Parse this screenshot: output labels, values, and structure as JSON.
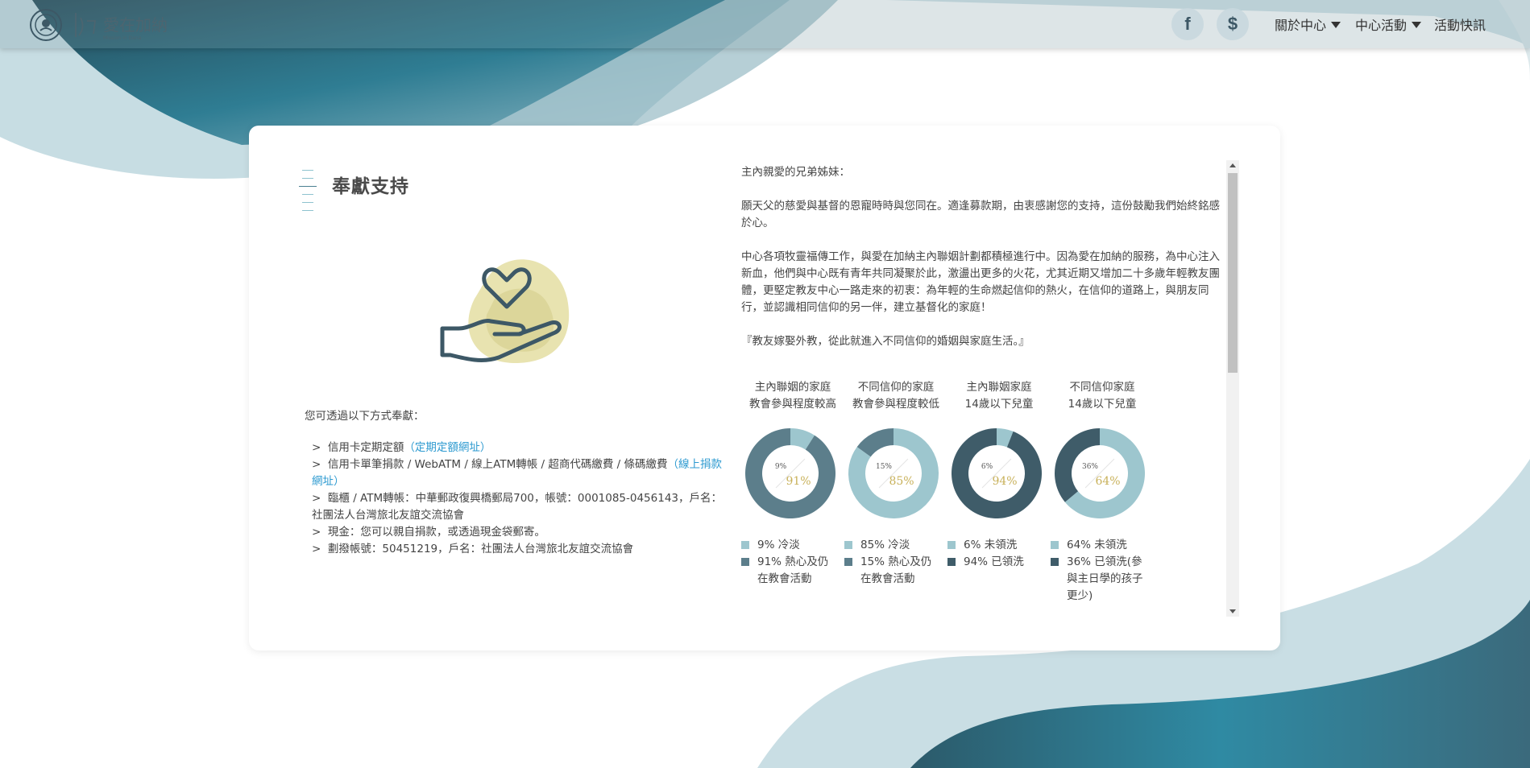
{
  "header": {
    "logo_alt": "愛在加納",
    "logo_subtitle": "Mission in Dana",
    "social": [
      {
        "name": "facebook-icon",
        "glyph": "f"
      },
      {
        "name": "donate-icon",
        "glyph": "$"
      }
    ],
    "nav": [
      {
        "label": "關於中心"
      },
      {
        "label": "中心活動"
      },
      {
        "label": "活動快訊"
      }
    ]
  },
  "page": {
    "title": "奉獻支持",
    "methods_intro": "您可透過以下方式奉獻：",
    "methods": [
      {
        "text": "信用卡定期定額",
        "link": "（定期定額網址）"
      },
      {
        "text": "信用卡單筆捐款 / WebATM / 線上ATM轉帳 / 超商代碼繳費 / 條碼繳費",
        "link": "（線上捐款網址）"
      },
      {
        "text": "臨櫃 / ATM轉帳：中華郵政復興橋郵局700，帳號：0001085-0456143，戶名：社團法人台灣旅北友誼交流協會",
        "link": ""
      },
      {
        "text": "現金：您可以親自捐款，或透過現金袋郵寄。",
        "link": ""
      },
      {
        "text": "劃撥帳號：50451219，戶名：社團法人台灣旅北友誼交流協會",
        "link": ""
      }
    ],
    "bullet": ">"
  },
  "letter": {
    "greeting": "主內親愛的兄弟姊妹：",
    "p1": "願天父的慈愛與基督的恩寵時時與您同在。適逢募款期，由衷感謝您的支持，這份鼓勵我們始終銘感於心。",
    "p2": "中心各項牧靈福傳工作，與愛在加納主內聯姻計劃都積極進行中。因為愛在加納的服務，為中心注入新血，他們與中心既有青年共同凝聚於此，激盪出更多的火花，尤其近期又增加二十多歲年輕教友團體，更堅定教友中心一路走來的初衷：為年輕的生命燃起信仰的熱火，在信仰的道路上，與朋友同行，並認識相同信仰的另一伴，建立基督化的家庭！",
    "p3": "『教友嫁娶外教，從此就進入不同信仰的婚姻與家庭生活。』"
  },
  "colors": {
    "light": "#9dc6ce",
    "dark": "#3f5c69",
    "mid": "#5c7e8b",
    "gold": "#c8b15a",
    "link": "#2d9ad0"
  },
  "chart_data": [
    {
      "type": "pie",
      "title": "主內聯姻的家庭\n教會參與程度較高",
      "title_lines": [
        "主內聯姻的家庭",
        "教會參與程度較高"
      ],
      "slices": [
        {
          "label": "9% 冷淡",
          "value": 9,
          "color": "#9dc6ce"
        },
        {
          "label": "91% 熱心及仍在教會活動",
          "value": 91,
          "color": "#5c7e8b"
        }
      ],
      "small_label": "9%",
      "big_label": "91%"
    },
    {
      "type": "pie",
      "title_lines": [
        "不同信仰的家庭",
        "教會參與程度較低"
      ],
      "slices": [
        {
          "label": "85% 冷淡",
          "value": 85,
          "color": "#9dc6ce"
        },
        {
          "label": "15% 熱心及仍在教會活動",
          "value": 15,
          "color": "#5c7e8b"
        }
      ],
      "small_label": "15%",
      "big_label": "85%"
    },
    {
      "type": "pie",
      "title_lines": [
        "主內聯姻家庭",
        "14歲以下兒童"
      ],
      "slices": [
        {
          "label": "6% 未領洗",
          "value": 6,
          "color": "#9dc6ce"
        },
        {
          "label": "94% 已領洗",
          "value": 94,
          "color": "#3f5c69"
        }
      ],
      "small_label": "6%",
      "big_label": "94%"
    },
    {
      "type": "pie",
      "title_lines": [
        "不同信仰家庭",
        "14歲以下兒童"
      ],
      "slices": [
        {
          "label": "64% 未領洗",
          "value": 64,
          "color": "#9dc6ce"
        },
        {
          "label": "36% 已領洗(參與主日學的孩子更少)",
          "value": 36,
          "color": "#3f5c69"
        }
      ],
      "small_label": "36%",
      "big_label": "64%"
    }
  ]
}
